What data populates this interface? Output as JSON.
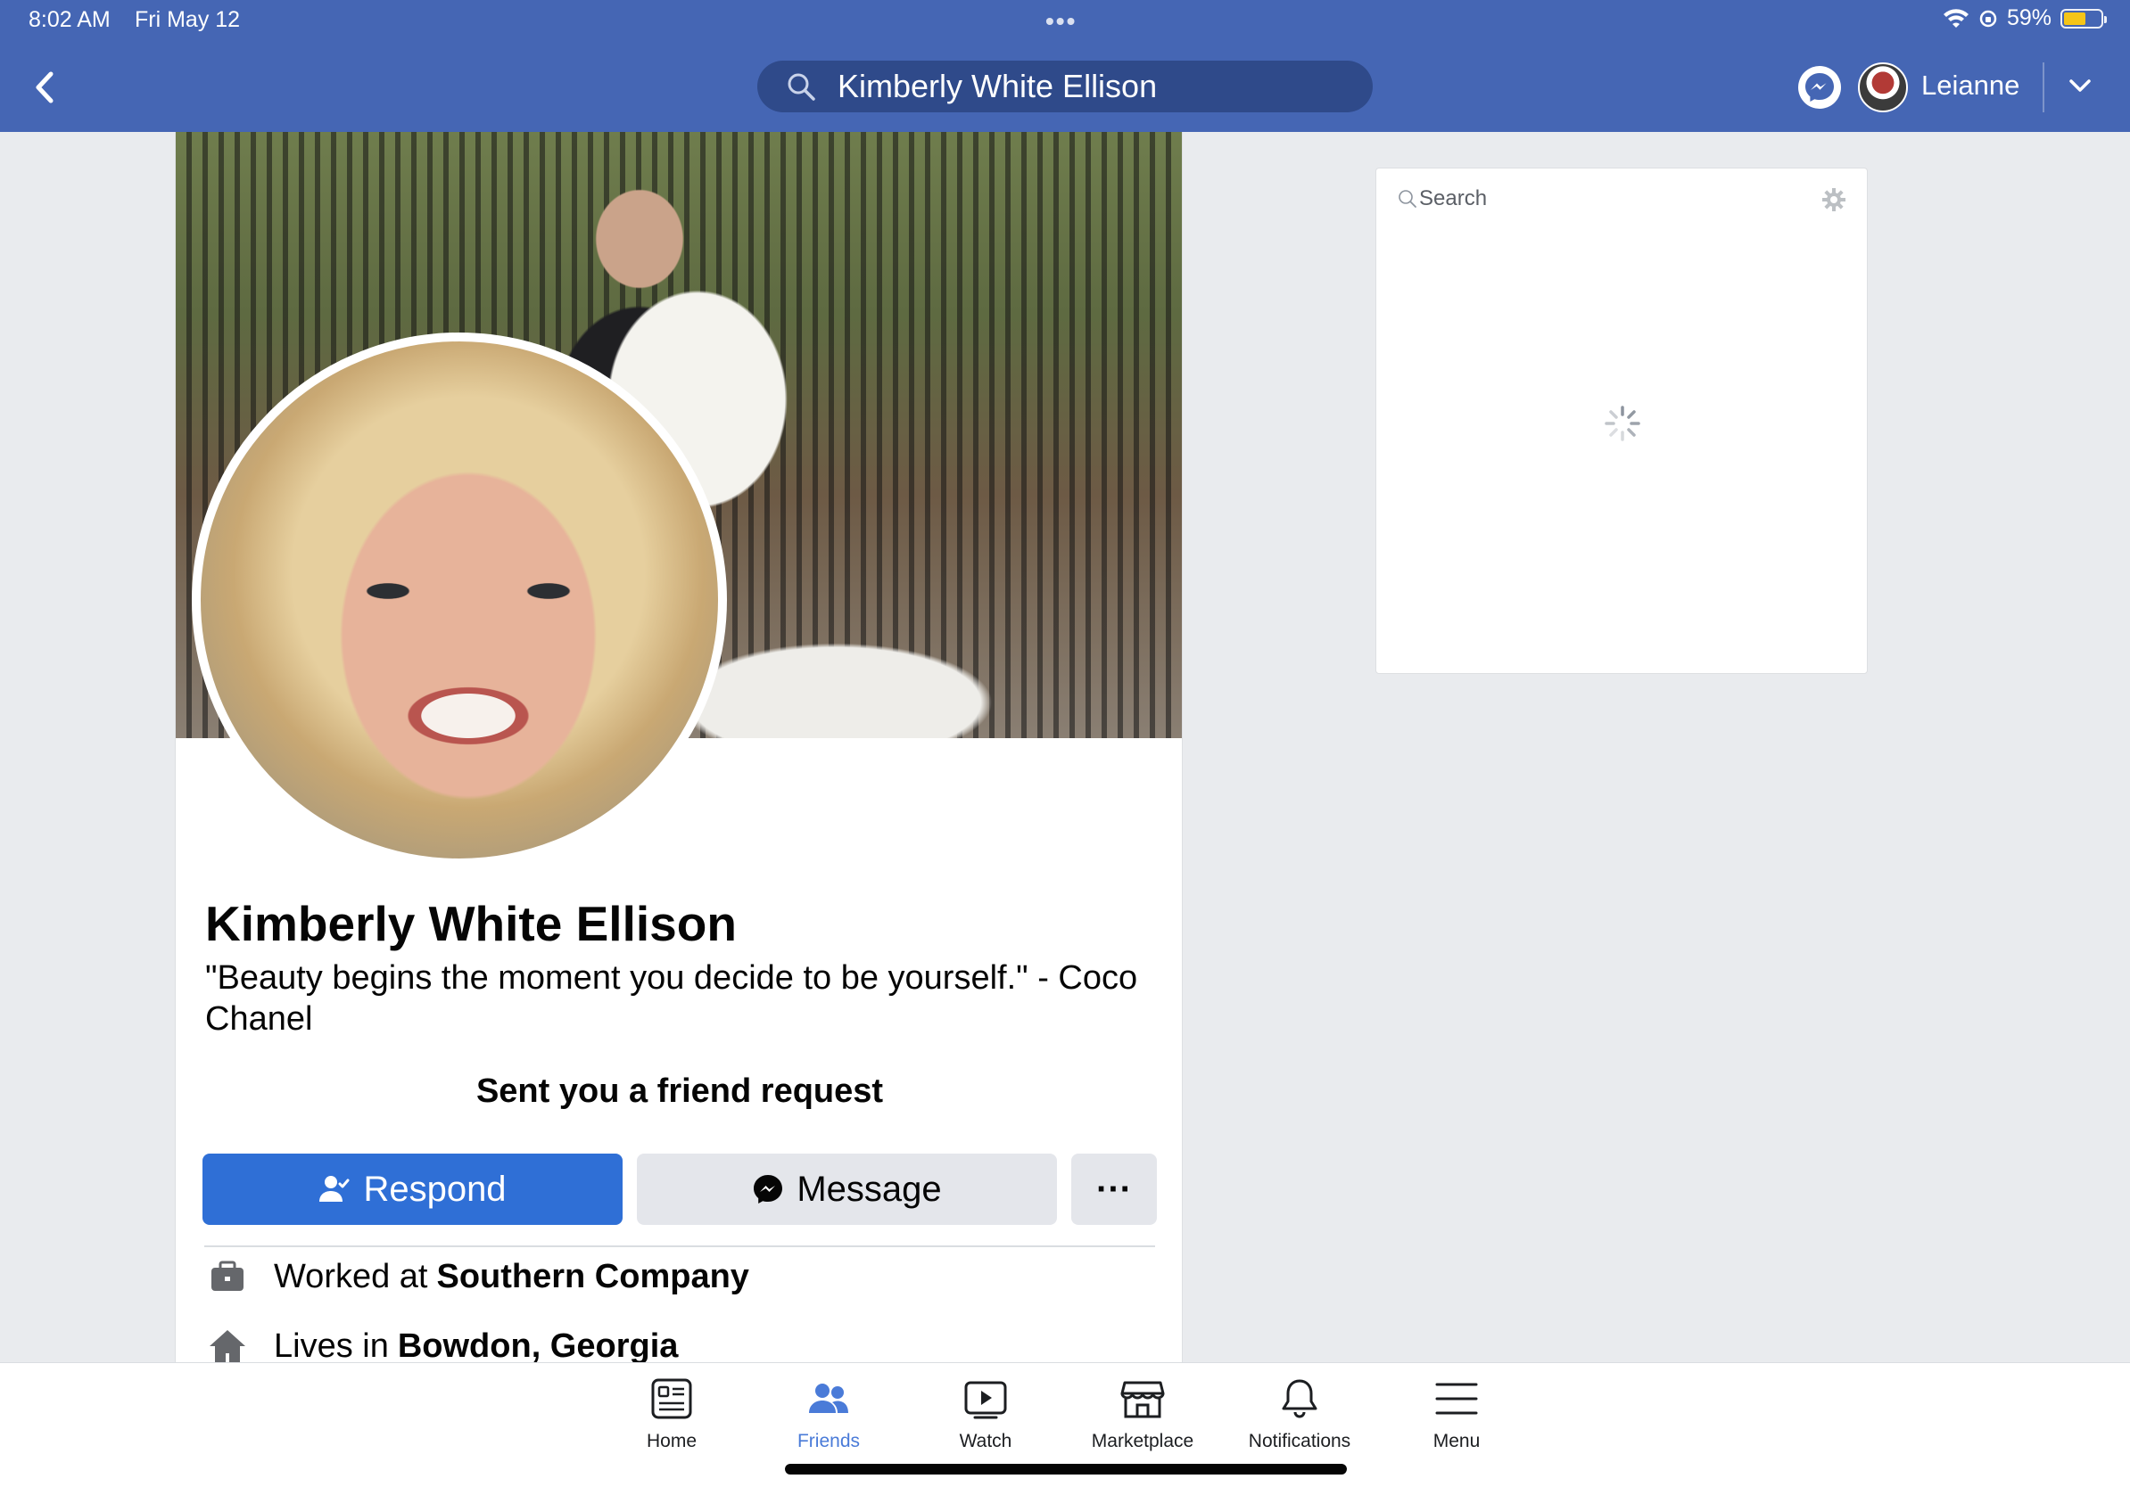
{
  "status_bar": {
    "time": "8:02 AM",
    "date": "Fri May 12",
    "battery": "59%",
    "battery_level": 0.59,
    "multitask_dots": "•••"
  },
  "header": {
    "search_query": "Kimberly White Ellison",
    "user_name": "Leianne"
  },
  "profile": {
    "name": "Kimberly White Ellison",
    "bio": "\"Beauty begins the moment you decide to be yourself.\" - Coco Chanel",
    "friend_request_text": "Sent you a friend request",
    "buttons": {
      "respond": "Respond",
      "message": "Message",
      "more": "···"
    },
    "info": [
      {
        "prefix": "Worked at",
        "value": "Southern Company",
        "icon": "briefcase-icon"
      },
      {
        "prefix": "Lives in",
        "value": "Bowdon, Georgia",
        "icon": "house-icon"
      }
    ]
  },
  "sidebar": {
    "search_placeholder": "Search"
  },
  "tabbar": {
    "tabs": [
      {
        "label": "Home",
        "icon": "home-feed-icon",
        "active": false
      },
      {
        "label": "Friends",
        "icon": "friends-icon",
        "active": true
      },
      {
        "label": "Watch",
        "icon": "watch-icon",
        "active": false
      },
      {
        "label": "Marketplace",
        "icon": "marketplace-icon",
        "active": false
      },
      {
        "label": "Notifications",
        "icon": "bell-icon",
        "active": false
      },
      {
        "label": "Menu",
        "icon": "menu-icon",
        "active": false
      }
    ]
  },
  "colors": {
    "header_bg": "#4566b4",
    "search_pill_bg": "#2f4a8a",
    "respond_button": "#2f6fd6",
    "secondary_button": "#e4e6eb",
    "active_tab": "#4a7bd8",
    "page_bg": "#e9ebee"
  }
}
